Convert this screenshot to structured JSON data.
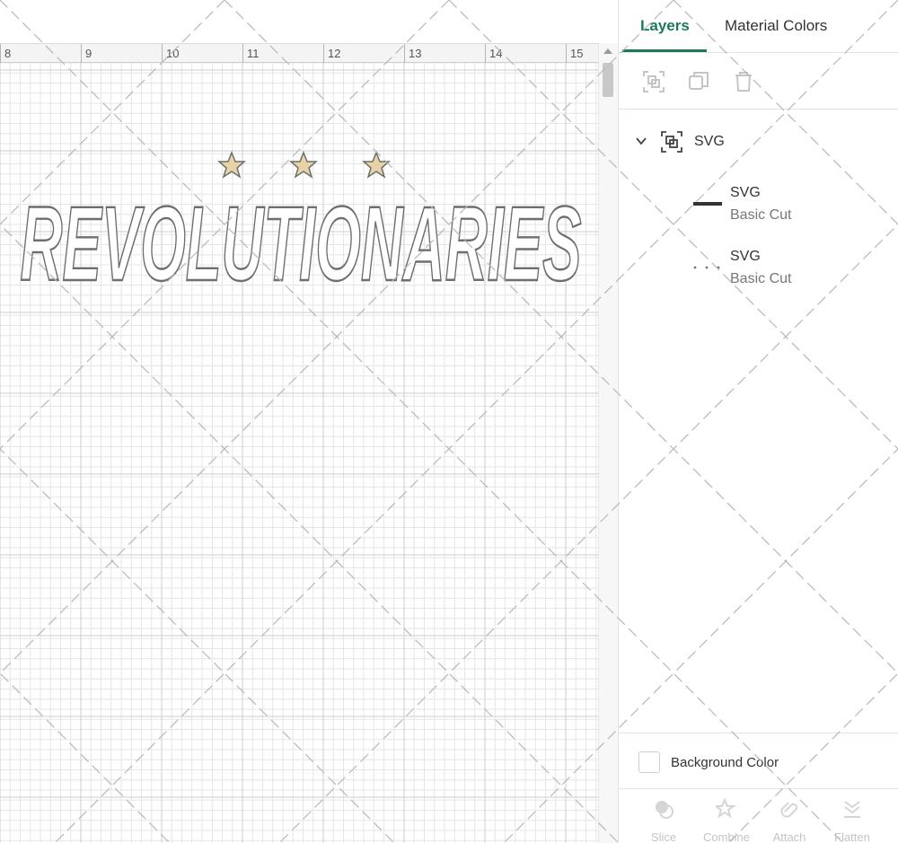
{
  "ruler": {
    "ticks": [
      "8",
      "9",
      "10",
      "11",
      "12",
      "13",
      "14",
      "15"
    ]
  },
  "design": {
    "text": "REVOLUTIONARIES",
    "stars": 3,
    "star_fill": "#e8d3a8",
    "outline_color": "#6e6e6e"
  },
  "panel": {
    "tabs": {
      "layers": "Layers",
      "material_colors": "Material Colors"
    },
    "accent_color": "#1c7a5c",
    "toolbar": {
      "icons": [
        "group-icon",
        "duplicate-icon",
        "delete-icon"
      ]
    },
    "group": {
      "label": "SVG"
    },
    "layers": [
      {
        "name": "SVG",
        "type": "Basic Cut",
        "preview": "solid-line"
      },
      {
        "name": "SVG",
        "type": "Basic Cut",
        "preview": "dotted-line"
      }
    ],
    "background": {
      "label": "Background Color"
    },
    "bottom_tools": [
      "Slice",
      "Combine",
      "Attach",
      "Flatten"
    ]
  }
}
